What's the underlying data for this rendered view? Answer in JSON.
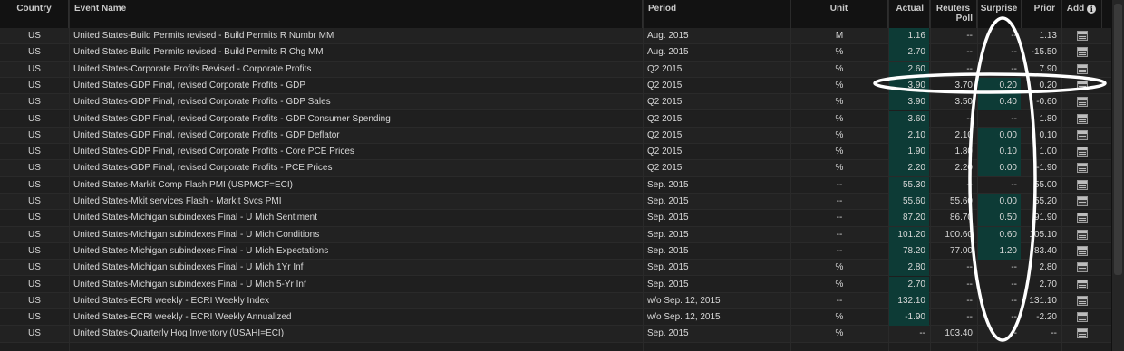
{
  "columns": {
    "country": "Country",
    "event": "Event Name",
    "period": "Period",
    "unit": "Unit",
    "actual": "Actual",
    "poll_line1": "Reuters",
    "poll_line2": "Poll",
    "surprise": "Surprise",
    "prior": "Prior",
    "add": "Add"
  },
  "rows": [
    {
      "country": "US",
      "event": "United States-Build Permits revised - Build Permits R Numbr MM",
      "period": "Aug. 2015",
      "unit": "M",
      "actual": "1.16",
      "poll": "--",
      "surprise": "--",
      "prior": "1.13",
      "hl_actual": true,
      "hl_surprise": false
    },
    {
      "country": "US",
      "event": "United States-Build Permits revised - Build Permits R Chg MM",
      "period": "Aug. 2015",
      "unit": "%",
      "actual": "2.70",
      "poll": "--",
      "surprise": "--",
      "prior": "-15.50",
      "hl_actual": true,
      "hl_surprise": false
    },
    {
      "country": "US",
      "event": "United States-Corporate Profits Revised - Corporate Profits",
      "period": "Q2 2015",
      "unit": "%",
      "actual": "2.60",
      "poll": "--",
      "surprise": "--",
      "prior": "7.90",
      "hl_actual": true,
      "hl_surprise": false
    },
    {
      "country": "US",
      "event": "United States-GDP Final, revised Corporate Profits - GDP",
      "period": "Q2 2015",
      "unit": "%",
      "actual": "3.90",
      "poll": "3.70",
      "surprise": "0.20",
      "prior": "0.20",
      "hl_actual": true,
      "hl_surprise": true
    },
    {
      "country": "US",
      "event": "United States-GDP Final, revised Corporate Profits - GDP Sales",
      "period": "Q2 2015",
      "unit": "%",
      "actual": "3.90",
      "poll": "3.50",
      "surprise": "0.40",
      "prior": "-0.60",
      "hl_actual": true,
      "hl_surprise": true
    },
    {
      "country": "US",
      "event": "United States-GDP Final, revised Corporate Profits - GDP Consumer Spending",
      "period": "Q2 2015",
      "unit": "%",
      "actual": "3.60",
      "poll": "--",
      "surprise": "--",
      "prior": "1.80",
      "hl_actual": true,
      "hl_surprise": false
    },
    {
      "country": "US",
      "event": "United States-GDP Final, revised Corporate Profits - GDP Deflator",
      "period": "Q2 2015",
      "unit": "%",
      "actual": "2.10",
      "poll": "2.10",
      "surprise": "0.00",
      "prior": "0.10",
      "hl_actual": true,
      "hl_surprise": true
    },
    {
      "country": "US",
      "event": "United States-GDP Final, revised Corporate Profits - Core PCE Prices",
      "period": "Q2 2015",
      "unit": "%",
      "actual": "1.90",
      "poll": "1.80",
      "surprise": "0.10",
      "prior": "1.00",
      "hl_actual": true,
      "hl_surprise": true
    },
    {
      "country": "US",
      "event": "United States-GDP Final, revised Corporate Profits - PCE Prices",
      "period": "Q2 2015",
      "unit": "%",
      "actual": "2.20",
      "poll": "2.20",
      "surprise": "0.00",
      "prior": "-1.90",
      "hl_actual": true,
      "hl_surprise": true
    },
    {
      "country": "US",
      "event": "United States-Markit Comp Flash PMI (USPMCF=ECI)",
      "period": "Sep. 2015",
      "unit": "--",
      "actual": "55.30",
      "poll": "--",
      "surprise": "--",
      "prior": "55.00",
      "hl_actual": true,
      "hl_surprise": false
    },
    {
      "country": "US",
      "event": "United States-Mkit services Flash - Markit Svcs PMI",
      "period": "Sep. 2015",
      "unit": "--",
      "actual": "55.60",
      "poll": "55.60",
      "surprise": "0.00",
      "prior": "55.20",
      "hl_actual": true,
      "hl_surprise": true
    },
    {
      "country": "US",
      "event": "United States-Michigan subindexes Final - U Mich Sentiment",
      "period": "Sep. 2015",
      "unit": "--",
      "actual": "87.20",
      "poll": "86.70",
      "surprise": "0.50",
      "prior": "91.90",
      "hl_actual": true,
      "hl_surprise": true
    },
    {
      "country": "US",
      "event": "United States-Michigan subindexes Final - U Mich Conditions",
      "period": "Sep. 2015",
      "unit": "--",
      "actual": "101.20",
      "poll": "100.60",
      "surprise": "0.60",
      "prior": "105.10",
      "hl_actual": true,
      "hl_surprise": true
    },
    {
      "country": "US",
      "event": "United States-Michigan subindexes Final - U Mich Expectations",
      "period": "Sep. 2015",
      "unit": "--",
      "actual": "78.20",
      "poll": "77.00",
      "surprise": "1.20",
      "prior": "83.40",
      "hl_actual": true,
      "hl_surprise": true
    },
    {
      "country": "US",
      "event": "United States-Michigan subindexes Final - U Mich 1Yr Inf",
      "period": "Sep. 2015",
      "unit": "%",
      "actual": "2.80",
      "poll": "--",
      "surprise": "--",
      "prior": "2.80",
      "hl_actual": true,
      "hl_surprise": false
    },
    {
      "country": "US",
      "event": "United States-Michigan subindexes Final - U Mich 5-Yr Inf",
      "period": "Sep. 2015",
      "unit": "%",
      "actual": "2.70",
      "poll": "--",
      "surprise": "--",
      "prior": "2.70",
      "hl_actual": true,
      "hl_surprise": false
    },
    {
      "country": "US",
      "event": "United States-ECRI weekly - ECRI Weekly Index",
      "period": "w/o Sep. 12, 2015",
      "unit": "--",
      "actual": "132.10",
      "poll": "--",
      "surprise": "--",
      "prior": "131.10",
      "hl_actual": true,
      "hl_surprise": false
    },
    {
      "country": "US",
      "event": "United States-ECRI weekly - ECRI Weekly Annualized",
      "period": "w/o Sep. 12, 2015",
      "unit": "%",
      "actual": "-1.90",
      "poll": "--",
      "surprise": "--",
      "prior": "-2.20",
      "hl_actual": true,
      "hl_surprise": false
    },
    {
      "country": "US",
      "event": "United States-Quarterly Hog Inventory (USAHI=ECI)",
      "period": "Sep. 2015",
      "unit": "%",
      "actual": "--",
      "poll": "103.40",
      "surprise": "--",
      "prior": "--",
      "hl_actual": false,
      "hl_surprise": false
    }
  ],
  "icons": {
    "add_row": "calendar-add-icon",
    "add_header": "info-icon"
  },
  "colors": {
    "highlight": "#0d3b36",
    "annotation": "#ffffff"
  }
}
